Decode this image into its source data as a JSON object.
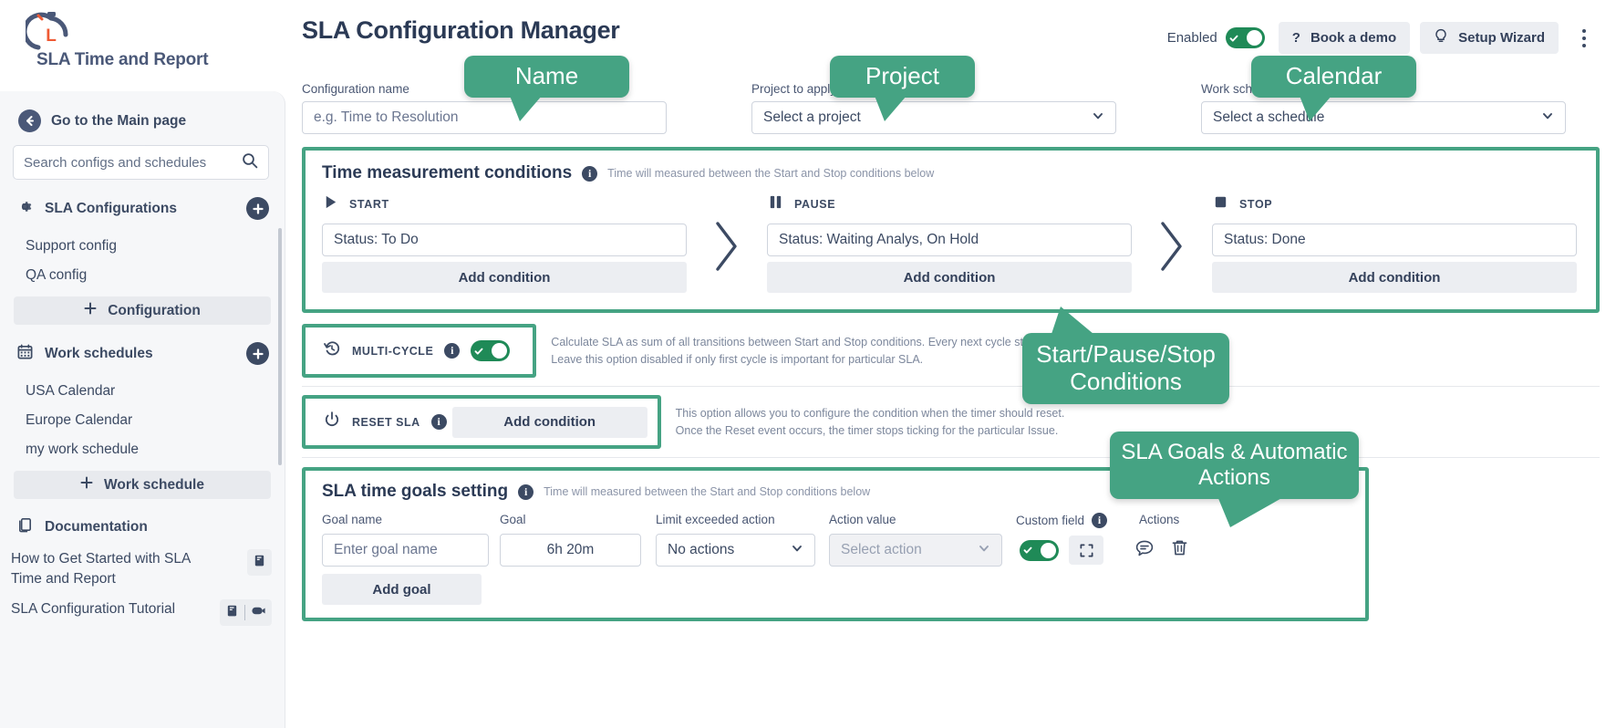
{
  "brand": {
    "name": "SLA Time and Report",
    "logo_icon": "stopwatch-logo-icon"
  },
  "sidebar": {
    "main_page_link": "Go to the Main page",
    "search_placeholder": "Search configs and schedules",
    "sections": [
      {
        "id": "sla-configurations",
        "title": "SLA Configurations",
        "icon": "gear-icon",
        "items": [
          "Support config",
          "QA config"
        ],
        "add_label": "Configuration"
      },
      {
        "id": "work-schedules",
        "title": "Work schedules",
        "icon": "calendar-icon",
        "items": [
          "USA Calendar",
          "Europe Calendar",
          "my work schedule"
        ],
        "add_label": "Work schedule"
      }
    ],
    "documentation": {
      "title": "Documentation",
      "icon": "documents-icon",
      "items": [
        {
          "text": "How to Get Started with SLA Time and Report",
          "icons": [
            "book-icon"
          ]
        },
        {
          "text": "SLA Configuration Tutorial",
          "icons": [
            "book-icon",
            "video-icon"
          ]
        }
      ]
    }
  },
  "header": {
    "title": "SLA Configuration Manager",
    "enabled_label": "Enabled",
    "enabled_state": "on",
    "book_demo": "Book a demo",
    "setup_wizard": "Setup Wizard",
    "more_menu": "kebab-menu"
  },
  "form": {
    "config_name": {
      "label": "Configuration name",
      "placeholder": "e.g. Time to Resolution",
      "value": ""
    },
    "project": {
      "label": "Project to apply SLA",
      "value": "Select a project"
    },
    "work_schedule": {
      "label": "Work schedule",
      "value": "Select a schedule"
    }
  },
  "time_conditions": {
    "title": "Time measurement conditions",
    "subtitle": "Time will measured between the Start and Stop conditions below",
    "columns": [
      {
        "icon": "play-icon",
        "label": "START",
        "value": "Status: To Do",
        "add_label": "Add condition"
      },
      {
        "icon": "pause-icon",
        "label": "PAUSE",
        "value": "Status: Waiting Analys, On Hold",
        "add_label": "Add condition"
      },
      {
        "icon": "stop-icon",
        "label": "STOP",
        "value": "Status: Done",
        "add_label": "Add condition"
      }
    ]
  },
  "multi_cycle": {
    "icon": "history-icon",
    "label": "MULTI-CYCLE",
    "state": "on",
    "description_line1": "Calculate SLA as sum of all transitions between Start and Stop conditions. Every next cycle starts",
    "description_line2": "Leave this option disabled if only first cycle is important for particular SLA."
  },
  "reset_sla": {
    "icon": "power-icon",
    "label": "RESET SLA",
    "add_label": "Add condition",
    "description_line1": "This option allows you to configure the condition when the timer should reset.",
    "description_line2": "Once the Reset event occurs, the timer stops ticking for the particular Issue."
  },
  "goals": {
    "title": "SLA time goals setting",
    "subtitle": "Time will measured between the Start and Stop conditions below",
    "columns": [
      "Goal name",
      "Goal",
      "Limit exceeded action",
      "Action value",
      "Custom field",
      "Actions"
    ],
    "row": {
      "goal_name_placeholder": "Enter goal name",
      "goal_value": "6h 20m",
      "limit_action": "No actions",
      "action_value": "Select action",
      "custom_field_state": "on",
      "expand_icon": "expand-icon",
      "comment_icon": "comment-icon",
      "delete_icon": "trash-icon"
    },
    "add_goal": "Add goal"
  },
  "callouts": [
    {
      "id": "name",
      "text": "Name"
    },
    {
      "id": "project",
      "text": "Project"
    },
    {
      "id": "calendar",
      "text": "Calendar"
    },
    {
      "id": "conditions",
      "text": "Start/Pause/Stop Conditions"
    },
    {
      "id": "goals",
      "text": "SLA Goals & Automatic Actions"
    }
  ],
  "colors": {
    "accent": "#45a383",
    "toggle_on": "#1f8a57",
    "text_dark": "#2b3a55",
    "brand_orange": "#ef5a34"
  }
}
